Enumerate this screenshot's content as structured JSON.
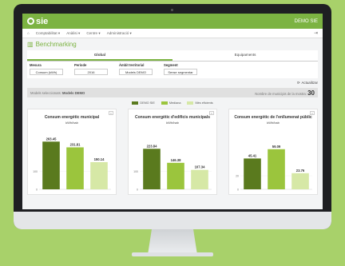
{
  "app": {
    "logo_text": "sie",
    "org": "DEMO SIE"
  },
  "menu": [
    {
      "icon": "home-icon",
      "label": "⌂"
    },
    {
      "icon": "bar-chart-icon",
      "label": "Comptabilitat ▾"
    },
    {
      "icon": "line-chart-icon",
      "label": "Anàlisi ▾"
    },
    {
      "icon": "building-icon",
      "label": "Centre ▾"
    },
    {
      "icon": "gear-icon",
      "label": "Administració ▾"
    }
  ],
  "page": {
    "title": "Benchmarking"
  },
  "tabs": [
    "Global",
    "Equipaments"
  ],
  "filters": [
    {
      "label": "Mesura",
      "value": "Consum (kWh)"
    },
    {
      "label": "Període",
      "value": "2016"
    },
    {
      "label": "Àmbit territorial",
      "value": "Models DEMO"
    },
    {
      "label": "Segment",
      "value": "Sense segmentar"
    }
  ],
  "update_label": "Actualitzar",
  "info": {
    "selected_label": "Models seleccionats:",
    "selected_value": "Models DEMO",
    "count_label": "Nombre de municipis de la mostra:",
    "count_value": "30"
  },
  "legend": [
    {
      "label": "DEMO SIE",
      "color": "#5a7a1e"
    },
    {
      "label": "Mediana",
      "color": "#9bc53d"
    },
    {
      "label": "Més eficients",
      "color": "#d6e8a6"
    }
  ],
  "chart_data": [
    {
      "type": "bar",
      "title": "Consum energètic municipal",
      "ylabel": "kWh/hab",
      "categories": [
        "DEMO SIE",
        "Mediana",
        "Més eficients"
      ],
      "values": [
        263.45,
        231.81,
        150.14
      ],
      "ylim": [
        0,
        300
      ],
      "yticks": [
        0,
        100
      ]
    },
    {
      "type": "bar",
      "title": "Consum energètic d'edificis municipals",
      "ylabel": "kWh/hab",
      "categories": [
        "DEMO SIE",
        "Mediana",
        "Més eficients"
      ],
      "values": [
        223.84,
        146.38,
        107.34
      ],
      "ylim": [
        0,
        300
      ],
      "yticks": [
        0,
        100
      ]
    },
    {
      "type": "bar",
      "title": "Consum energètic de l'enllumenat públic",
      "ylabel": "kWh/hab",
      "categories": [
        "DEMO SIE",
        "Mediana",
        "Més eficients"
      ],
      "values": [
        45.41,
        59.09,
        23.76
      ],
      "ylim": [
        0,
        80
      ],
      "yticks": [
        0,
        20
      ]
    }
  ]
}
